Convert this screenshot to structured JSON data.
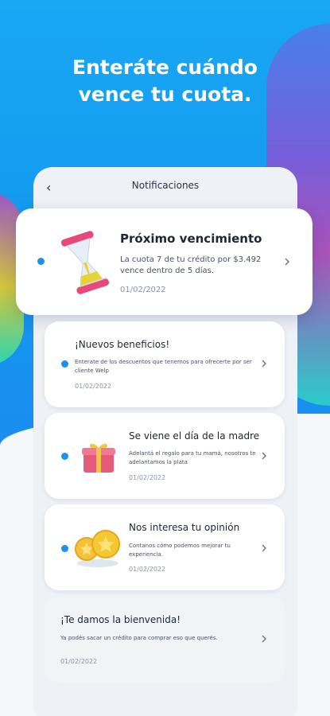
{
  "promo": {
    "line1": "Enteráte cuándo",
    "line2": "vence tu cuota."
  },
  "screen": {
    "title": "Notificaciones",
    "back_icon": "chevron-left-icon"
  },
  "notifications": [
    {
      "title": "Próximo vencimiento",
      "body": "La cuota 7 de tu crédito por $3.492 vence dentro de 5 días.",
      "date": "01/02/2022",
      "icon": "hourglass-icon",
      "unread": true
    },
    {
      "title": "¡Nuevos beneficios!",
      "body": "Enterate de los descuentos que tenemos para ofrecerte por ser cliente Welp",
      "date": "01/02/2022",
      "unread": true
    },
    {
      "title": "Se viene el día de la madre",
      "body": "Adelantá el regalo para tu mamá, nosotros te adelantamos la plata",
      "date": "01/02/2022",
      "icon": "gift-icon",
      "unread": true
    },
    {
      "title": "Nos interesa tu opinión",
      "body": "Contanos cómo podemos mejorar tu experiencia.",
      "date": "01/02/2022",
      "icon": "star-medals-icon",
      "unread": true
    },
    {
      "title": "¡Te damos la bienvenida!",
      "body": "Ya podés sacar un crédito para comprar eso que querés.",
      "date": "01/02/2022",
      "unread": false
    }
  ],
  "colors": {
    "primary": "#1a90ef",
    "background": "#f6f7fb"
  }
}
